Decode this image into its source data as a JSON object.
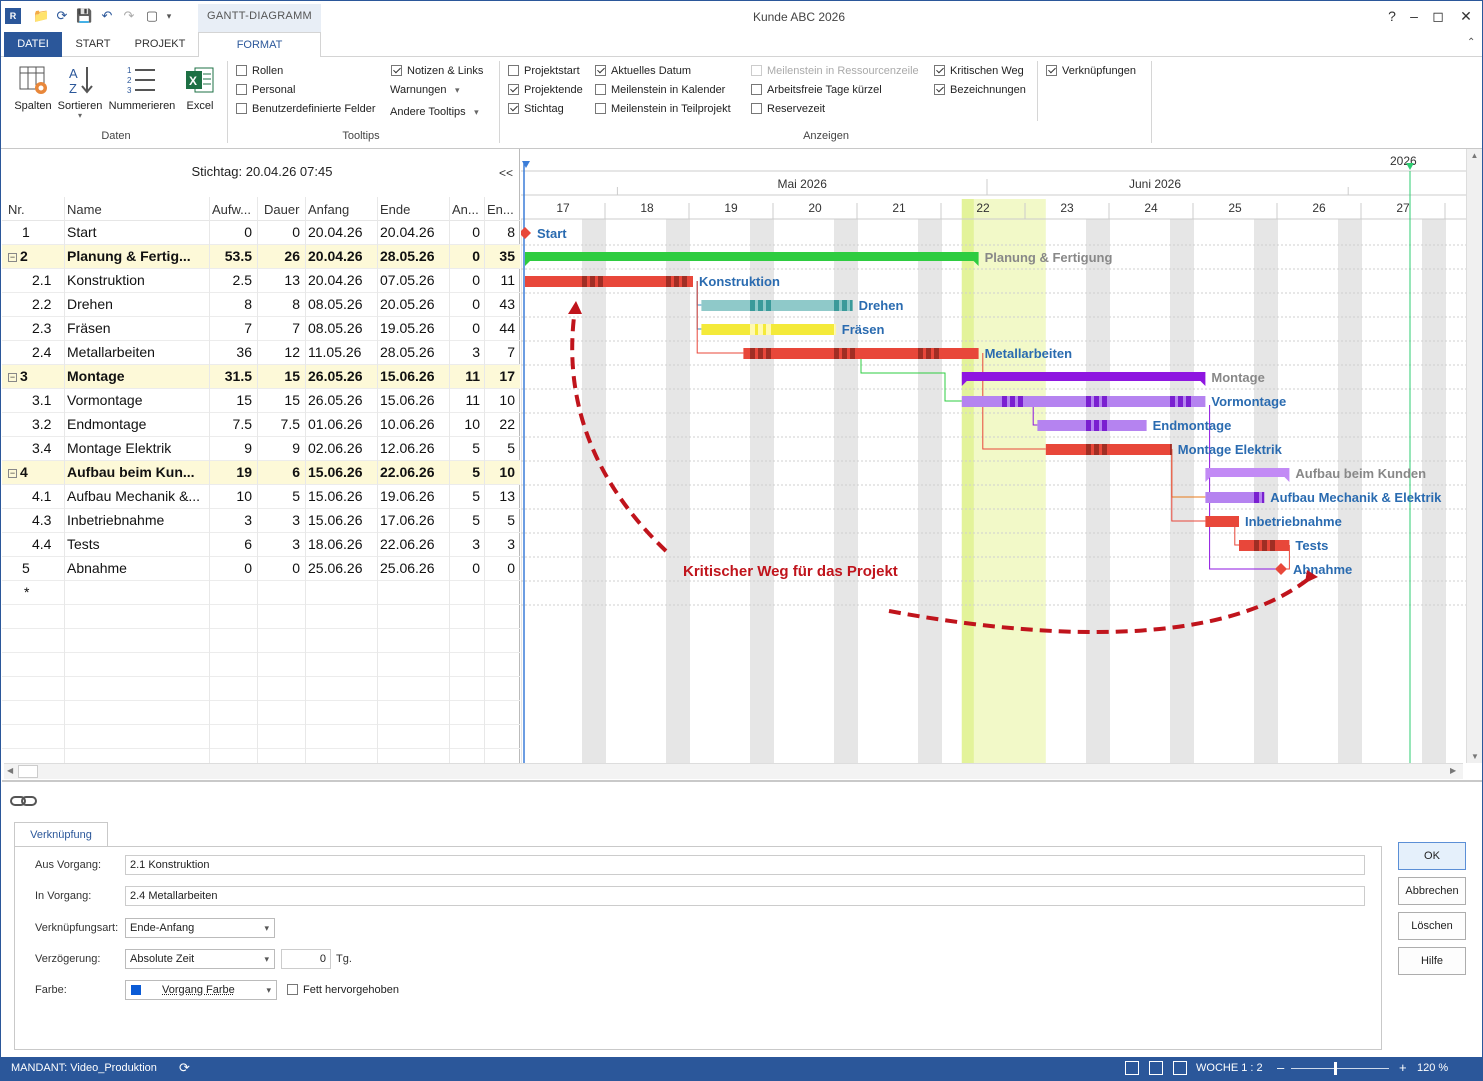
{
  "app": {
    "window_title": "Kunde ABC 2026",
    "context_tab": "GANTT-DIAGRAMM"
  },
  "tabs": [
    {
      "label": "DATEI"
    },
    {
      "label": "START"
    },
    {
      "label": "PROJEKT"
    },
    {
      "label": "FORMAT"
    }
  ],
  "ribbon": {
    "daten": {
      "label": "Daten",
      "buttons": [
        {
          "label": "Spalten",
          "icon": "columns-gear-icon"
        },
        {
          "label": "Sortieren",
          "icon": "sort-az-icon"
        },
        {
          "label": "Nummerieren",
          "icon": "numbered-list-icon"
        },
        {
          "label": "Excel",
          "icon": "excel-icon"
        }
      ]
    },
    "tooltips": {
      "label": "Tooltips",
      "checks": [
        {
          "label": "Rollen",
          "checked": false
        },
        {
          "label": "Personal",
          "checked": false
        },
        {
          "label": "Benutzerdefinierte Felder",
          "checked": false
        },
        {
          "label": "Notizen & Links",
          "checked": true
        }
      ],
      "dropdowns": [
        "Warnungen",
        "Andere Tooltips"
      ]
    },
    "anzeigen": {
      "label": "Anzeigen",
      "checks": [
        {
          "label": "Projektstart",
          "checked": false,
          "disabled": false
        },
        {
          "label": "Projektende",
          "checked": true,
          "disabled": false
        },
        {
          "label": "Stichtag",
          "checked": true,
          "disabled": false
        },
        {
          "label": "Aktuelles Datum",
          "checked": true,
          "disabled": false
        },
        {
          "label": "Meilenstein in Kalender",
          "checked": false,
          "disabled": false
        },
        {
          "label": "Meilenstein in Teilprojekt",
          "checked": false,
          "disabled": false
        },
        {
          "label": "Meilenstein in Ressourcenzeile",
          "checked": false,
          "disabled": true
        },
        {
          "label": "Arbeitsfreie Tage kürzel",
          "checked": false,
          "disabled": false
        },
        {
          "label": "Reservezeit",
          "checked": false,
          "disabled": false
        },
        {
          "label": "Kritischen Weg",
          "checked": true,
          "disabled": false
        },
        {
          "label": "Bezeichnungen",
          "checked": true,
          "disabled": false
        },
        {
          "label": "Verknüpfungen",
          "checked": true,
          "disabled": false
        }
      ]
    }
  },
  "grid": {
    "stichtag": "Stichtag: 20.04.26 07:45",
    "collapse_label": "<<",
    "columns": [
      "Nr.",
      "Name",
      "Aufw...",
      "Dauer",
      "Anfang",
      "Ende",
      "An...",
      "En..."
    ],
    "rows": [
      {
        "nr": "1",
        "name": "Start",
        "aufw": "0",
        "dauer": "0",
        "anfang": "20.04.26",
        "ende": "20.04.26",
        "an": "0",
        "en": "8",
        "summary": false,
        "indent": 0
      },
      {
        "nr": "2",
        "name": "Planung & Fertig...",
        "aufw": "53.5",
        "dauer": "26",
        "anfang": "20.04.26",
        "ende": "28.05.26",
        "an": "0",
        "en": "35",
        "summary": true,
        "indent": 0
      },
      {
        "nr": "2.1",
        "name": "Konstruktion",
        "aufw": "2.5",
        "dauer": "13",
        "anfang": "20.04.26",
        "ende": "07.05.26",
        "an": "0",
        "en": "11",
        "summary": false,
        "indent": 1
      },
      {
        "nr": "2.2",
        "name": "Drehen",
        "aufw": "8",
        "dauer": "8",
        "anfang": "08.05.26",
        "ende": "20.05.26",
        "an": "0",
        "en": "43",
        "summary": false,
        "indent": 1
      },
      {
        "nr": "2.3",
        "name": "Fräsen",
        "aufw": "7",
        "dauer": "7",
        "anfang": "08.05.26",
        "ende": "19.05.26",
        "an": "0",
        "en": "44",
        "summary": false,
        "indent": 1
      },
      {
        "nr": "2.4",
        "name": "Metallarbeiten",
        "aufw": "36",
        "dauer": "12",
        "anfang": "11.05.26",
        "ende": "28.05.26",
        "an": "3",
        "en": "7",
        "summary": false,
        "indent": 1
      },
      {
        "nr": "3",
        "name": "Montage",
        "aufw": "31.5",
        "dauer": "15",
        "anfang": "26.05.26",
        "ende": "15.06.26",
        "an": "11",
        "en": "17",
        "summary": true,
        "indent": 0
      },
      {
        "nr": "3.1",
        "name": "Vormontage",
        "aufw": "15",
        "dauer": "15",
        "anfang": "26.05.26",
        "ende": "15.06.26",
        "an": "11",
        "en": "10",
        "summary": false,
        "indent": 1
      },
      {
        "nr": "3.2",
        "name": "Endmontage",
        "aufw": "7.5",
        "dauer": "7.5",
        "anfang": "01.06.26",
        "ende": "10.06.26",
        "an": "10",
        "en": "22",
        "summary": false,
        "indent": 1
      },
      {
        "nr": "3.4",
        "name": "Montage Elektrik",
        "aufw": "9",
        "dauer": "9",
        "anfang": "02.06.26",
        "ende": "12.06.26",
        "an": "5",
        "en": "5",
        "summary": false,
        "indent": 1
      },
      {
        "nr": "4",
        "name": "Aufbau beim Kun...",
        "aufw": "19",
        "dauer": "6",
        "anfang": "15.06.26",
        "ende": "22.06.26",
        "an": "5",
        "en": "10",
        "summary": true,
        "indent": 0
      },
      {
        "nr": "4.1",
        "name": "Aufbau Mechanik &...",
        "aufw": "10",
        "dauer": "5",
        "anfang": "15.06.26",
        "ende": "19.06.26",
        "an": "5",
        "en": "13",
        "summary": false,
        "indent": 1
      },
      {
        "nr": "4.3",
        "name": "Inbetriebnahme",
        "aufw": "3",
        "dauer": "3",
        "anfang": "15.06.26",
        "ende": "17.06.26",
        "an": "5",
        "en": "5",
        "summary": false,
        "indent": 1
      },
      {
        "nr": "4.4",
        "name": "Tests",
        "aufw": "6",
        "dauer": "3",
        "anfang": "18.06.26",
        "ende": "22.06.26",
        "an": "3",
        "en": "3",
        "summary": false,
        "indent": 1
      },
      {
        "nr": "5",
        "name": "Abnahme",
        "aufw": "0",
        "dauer": "0",
        "anfang": "25.06.26",
        "ende": "25.06.26",
        "an": "0",
        "en": "0",
        "summary": false,
        "indent": 0
      },
      {
        "nr": "*",
        "name": "",
        "aufw": "",
        "dauer": "",
        "anfang": "",
        "ende": "",
        "an": "",
        "en": "",
        "summary": false,
        "indent": 0
      }
    ]
  },
  "gantt": {
    "year_label": "2026",
    "months": [
      "Mai 2026",
      "Juni 2026"
    ],
    "weeks": [
      "17",
      "18",
      "19",
      "20",
      "21",
      "22",
      "23",
      "24",
      "25",
      "26",
      "27"
    ],
    "annotation": "Kritischer Weg für das Projekt",
    "bars": [
      {
        "label": "Start",
        "kind": "milestone",
        "row": 0,
        "start_week": 17.0,
        "end_week": 17.0,
        "color": "#e8473a",
        "label_color": "#2a6bb0"
      },
      {
        "label": "Planung & Fertigung",
        "kind": "summary",
        "row": 1,
        "start_week": 17.0,
        "end_week": 22.4,
        "color": "#2ecc40",
        "label_color": "#888888"
      },
      {
        "label": "Konstruktion",
        "kind": "critical",
        "row": 2,
        "start_week": 17.0,
        "end_week": 19.0,
        "color": "#e8473a",
        "label_color": "#2a6bb0"
      },
      {
        "label": "Drehen",
        "kind": "task",
        "row": 3,
        "start_week": 19.1,
        "end_week": 20.9,
        "color": "#8fc9c9",
        "label_color": "#2a6bb0"
      },
      {
        "label": "Fräsen",
        "kind": "task",
        "row": 4,
        "start_week": 19.1,
        "end_week": 20.7,
        "color": "#f4ea3a",
        "label_color": "#2a6bb0"
      },
      {
        "label": "Metallarbeiten",
        "kind": "critical",
        "row": 5,
        "start_week": 19.6,
        "end_week": 22.4,
        "color": "#e8473a",
        "label_color": "#2a6bb0"
      },
      {
        "label": "Montage",
        "kind": "summary",
        "row": 6,
        "start_week": 22.2,
        "end_week": 25.1,
        "color": "#8e16e0",
        "label_color": "#888888"
      },
      {
        "label": "Vormontage",
        "kind": "task",
        "row": 7,
        "start_week": 22.2,
        "end_week": 25.1,
        "color": "#b583f0",
        "label_color": "#2a6bb0"
      },
      {
        "label": "Endmontage",
        "kind": "task",
        "row": 8,
        "start_week": 23.1,
        "end_week": 24.4,
        "color": "#b583f0",
        "label_color": "#2a6bb0"
      },
      {
        "label": "Montage Elektrik",
        "kind": "critical",
        "row": 9,
        "start_week": 23.2,
        "end_week": 24.7,
        "color": "#e8473a",
        "label_color": "#2a6bb0"
      },
      {
        "label": "Aufbau beim Kunden",
        "kind": "summary",
        "row": 10,
        "start_week": 25.1,
        "end_week": 26.1,
        "color": "#c28af5",
        "label_color": "#888888"
      },
      {
        "label": "Aufbau Mechanik & Elektrik",
        "kind": "task",
        "row": 11,
        "start_week": 25.1,
        "end_week": 25.8,
        "color": "#b583f0",
        "label_color": "#2a6bb0"
      },
      {
        "label": "Inbetriebnahme",
        "kind": "critical",
        "row": 12,
        "start_week": 25.1,
        "end_week": 25.5,
        "color": "#e8473a",
        "label_color": "#2a6bb0"
      },
      {
        "label": "Tests",
        "kind": "critical",
        "row": 13,
        "start_week": 25.5,
        "end_week": 26.1,
        "color": "#e8473a",
        "label_color": "#2a6bb0"
      },
      {
        "label": "Abnahme",
        "kind": "milestone",
        "row": 14,
        "start_week": 26.0,
        "end_week": 26.0,
        "color": "#e8473a",
        "label_color": "#2a6bb0"
      }
    ]
  },
  "link_dialog": {
    "tab_label": "Verknüpfung",
    "fields": {
      "aus_vorgang_label": "Aus Vorgang:",
      "aus_vorgang_value": "2.1 Konstruktion",
      "in_vorgang_label": "In Vorgang:",
      "in_vorgang_value": "2.4 Metallarbeiten",
      "art_label": "Verknüpfungsart:",
      "art_value": "Ende-Anfang",
      "verz_label": "Verzögerung:",
      "verz_value": "Absolute Zeit",
      "verz_amount": "0",
      "verz_unit": "Tg.",
      "farbe_label": "Farbe:",
      "farbe_value": "Vorgang Farbe",
      "fett_label": "Fett hervorgehoben"
    },
    "buttons": {
      "ok": "OK",
      "cancel": "Abbrechen",
      "delete": "Löschen",
      "help": "Hilfe"
    }
  },
  "status": {
    "mandant": "MANDANT: Video_Produktion",
    "zoom_label": "WOCHE 1 : 2",
    "zoom_percent": "120 %"
  },
  "colors": {
    "accent": "#2b579a",
    "critical": "#e8473a",
    "annotation": "#c0141c",
    "summary_row": "#fdf9d8"
  }
}
